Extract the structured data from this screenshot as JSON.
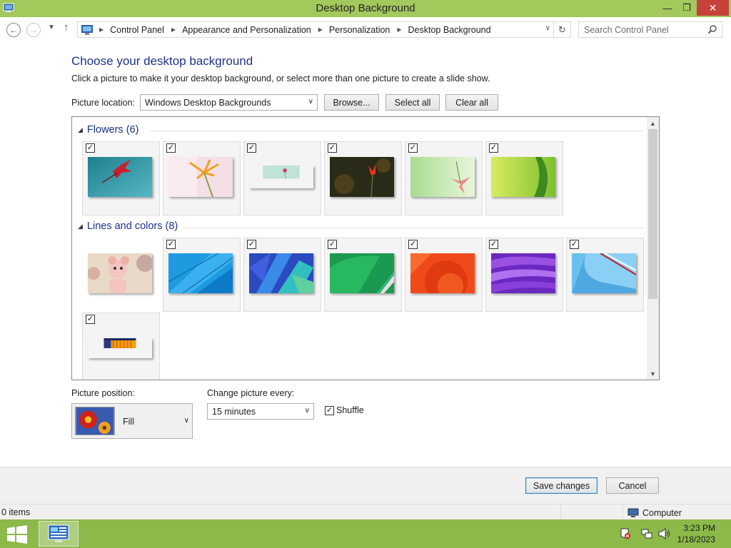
{
  "window": {
    "title": "Desktop Background"
  },
  "address": {
    "crumbs": [
      "Control Panel",
      "Appearance and Personalization",
      "Personalization",
      "Desktop Background"
    ],
    "search_placeholder": "Search Control Panel"
  },
  "main": {
    "heading": "Choose your desktop background",
    "subheading": "Click a picture to make it your desktop background, or select more than one picture to create a slide show.",
    "location_label": "Picture location:",
    "location_value": "Windows Desktop Backgrounds",
    "browse_label": "Browse...",
    "select_all_label": "Select all",
    "clear_all_label": "Clear all"
  },
  "gallery": {
    "groups": [
      {
        "title": "Flowers (6)",
        "items": [
          {
            "name": "flowers-1",
            "checked": true
          },
          {
            "name": "flowers-2",
            "checked": true
          },
          {
            "name": "flowers-3",
            "checked": true
          },
          {
            "name": "flowers-4",
            "checked": true
          },
          {
            "name": "flowers-5",
            "checked": true
          },
          {
            "name": "flowers-6",
            "checked": true
          }
        ]
      },
      {
        "title": "Lines and colors (8)",
        "items": [
          {
            "name": "cartoon",
            "checked": false
          },
          {
            "name": "lines-blue",
            "checked": true
          },
          {
            "name": "lines-kite",
            "checked": true
          },
          {
            "name": "lines-green",
            "checked": true
          },
          {
            "name": "lines-red",
            "checked": true
          },
          {
            "name": "lines-purple",
            "checked": true
          },
          {
            "name": "lines-lightblue",
            "checked": true
          },
          {
            "name": "lines-orange",
            "checked": true
          }
        ]
      }
    ]
  },
  "options": {
    "position_label": "Picture position:",
    "position_value": "Fill",
    "interval_label": "Change picture every:",
    "interval_value": "15 minutes",
    "shuffle_label": "Shuffle",
    "shuffle_checked": true
  },
  "footer": {
    "save_label": "Save changes",
    "cancel_label": "Cancel"
  },
  "status": {
    "items_text": "0 items",
    "location_text": "Computer"
  },
  "taskbar": {
    "time": "3:23 PM",
    "date": "1/18/2023"
  },
  "colors": {
    "titlebar": "#a3c85c",
    "taskbar": "#8cb94a",
    "heading": "#1e3287"
  }
}
